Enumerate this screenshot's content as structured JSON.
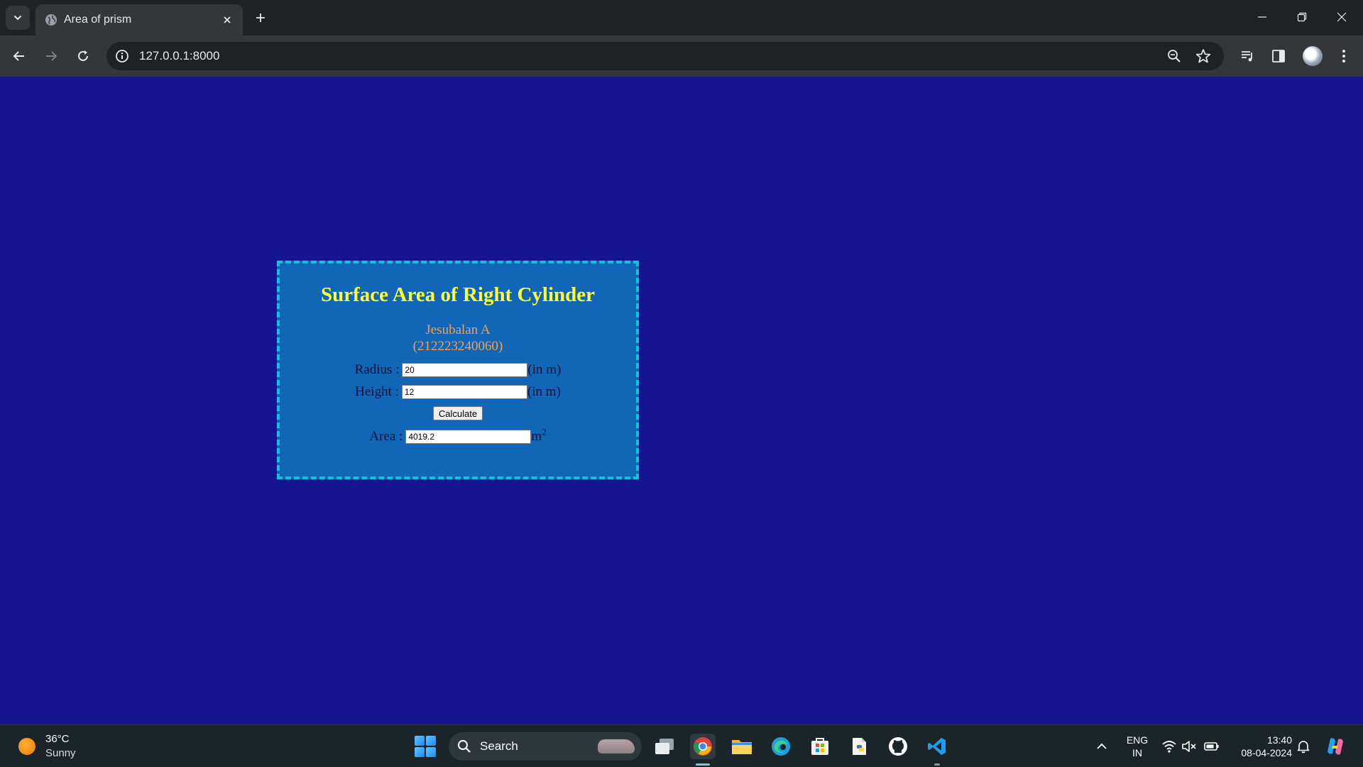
{
  "browser": {
    "tab_title": "Area of prism",
    "url": "127.0.0.1:8000",
    "icons": [
      "tab-list-icon",
      "globe-icon",
      "close-icon",
      "plus-icon",
      "minimize-icon",
      "restore-icon",
      "window-close-icon",
      "back-icon",
      "forward-icon",
      "reload-icon",
      "info-icon",
      "zoom-icon",
      "star-icon",
      "media-icon",
      "side-panel-icon",
      "menu-icon"
    ]
  },
  "page": {
    "title": "Surface Area of Right Cylinder",
    "author_name": "Jesubalan A",
    "author_id": "(212223240060)",
    "radius": {
      "label": "Radius :",
      "value": "20",
      "unit": "(in m)"
    },
    "height": {
      "label": "Height :",
      "value": "12",
      "unit": "(in m)"
    },
    "calculate_label": "Calculate",
    "area": {
      "label": "Area :",
      "value": "4019.2",
      "unit": "m",
      "exponent": "2"
    },
    "colors": {
      "background": "#151591",
      "card": "#1266b8",
      "border": "#13c1d8",
      "title": "#ffff33",
      "author": "#f4a04a"
    }
  },
  "taskbar": {
    "weather_temp": "36°C",
    "weather_condition": "Sunny",
    "search_label": "Search",
    "lang_line1": "ENG",
    "lang_line2": "IN",
    "time": "13:40",
    "date": "08-04-2024"
  }
}
